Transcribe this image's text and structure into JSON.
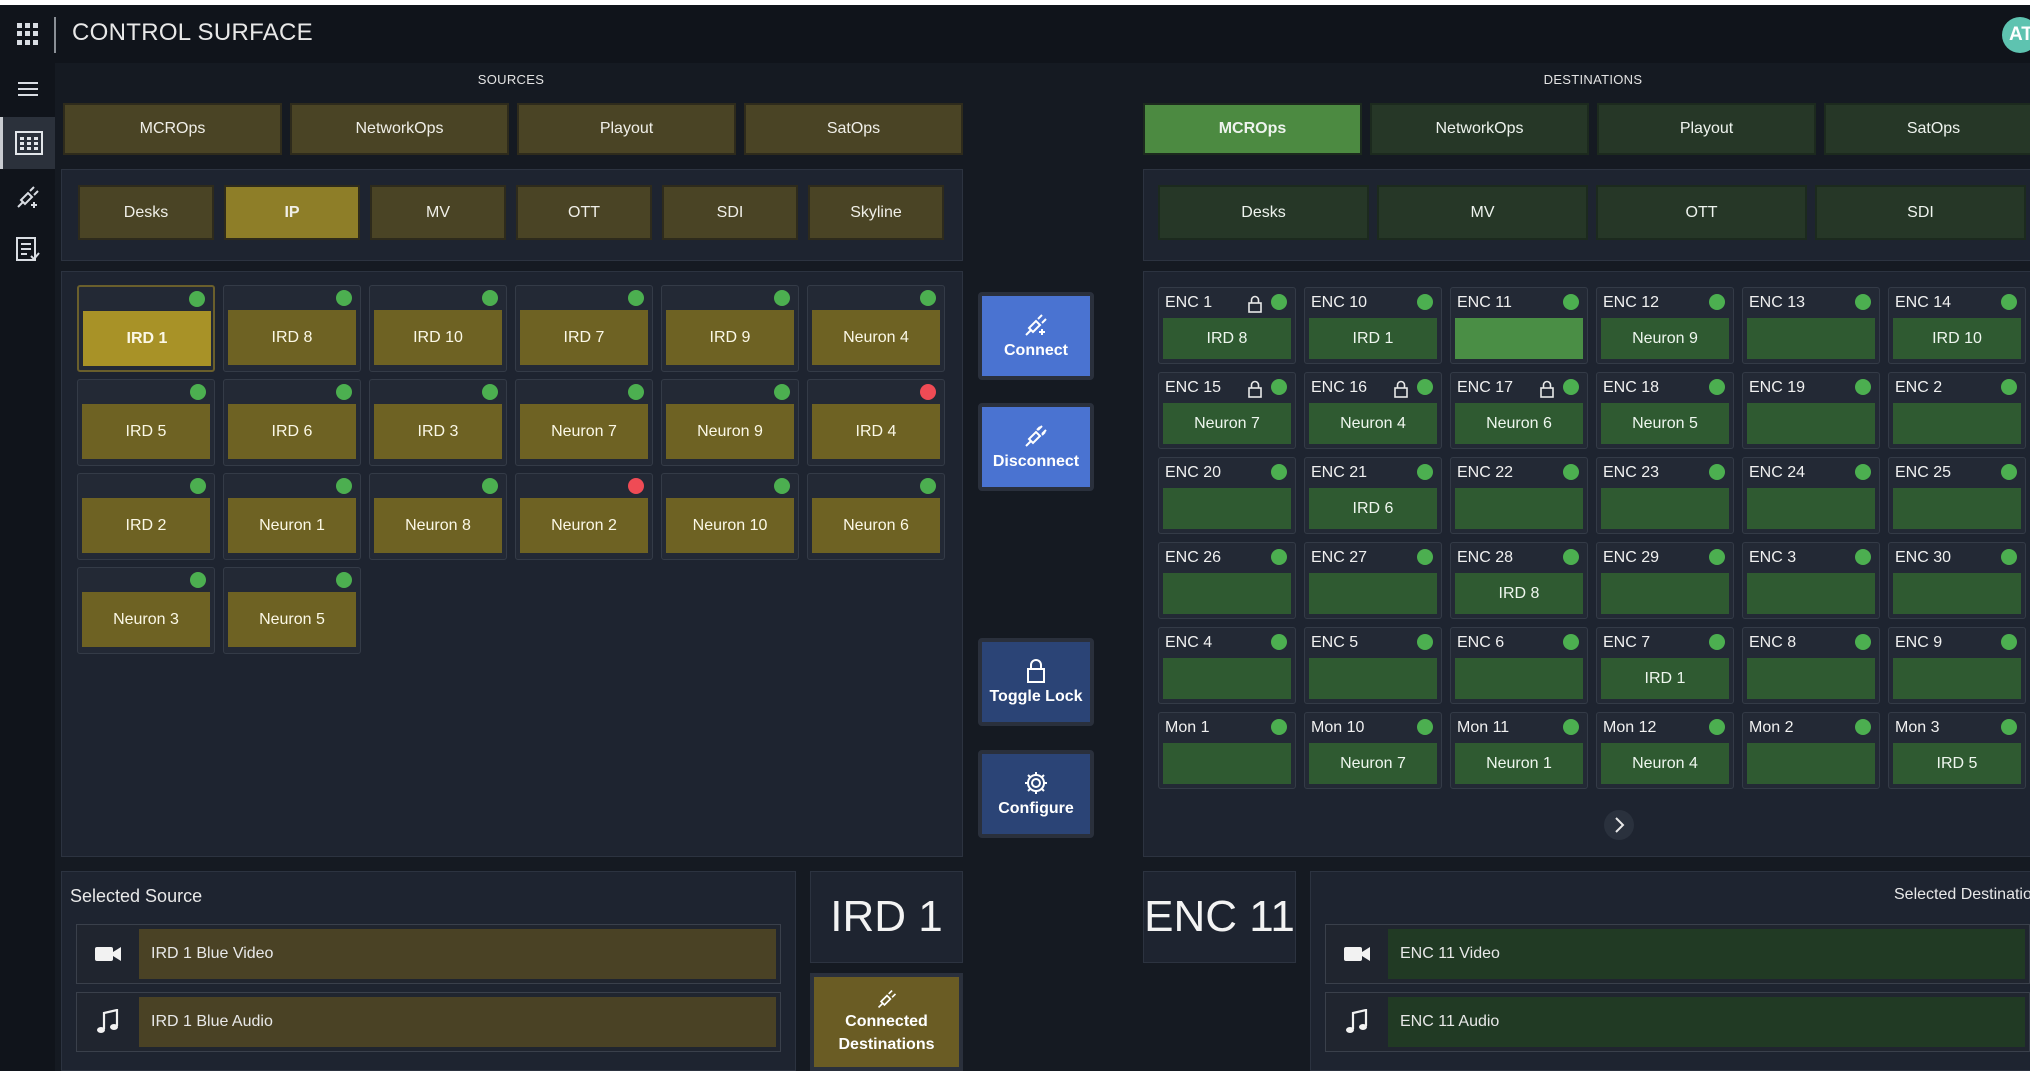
{
  "app": {
    "title": "CONTROL SURFACE",
    "user_initials": "AT"
  },
  "sidebar": {
    "icons": [
      "menu-icon",
      "grid-panel-icon",
      "connect-plug-icon",
      "list-check-icon"
    ]
  },
  "sources": {
    "header": "SOURCES",
    "groups": [
      {
        "label": "MCROps",
        "selected": false
      },
      {
        "label": "NetworkOps",
        "selected": false
      },
      {
        "label": "Playout",
        "selected": false
      },
      {
        "label": "SatOps",
        "selected": false
      }
    ],
    "categories": [
      {
        "label": "Desks",
        "selected": false
      },
      {
        "label": "IP",
        "selected": true
      },
      {
        "label": "MV",
        "selected": false
      },
      {
        "label": "OTT",
        "selected": false
      },
      {
        "label": "SDI",
        "selected": false
      },
      {
        "label": "Skyline",
        "selected": false
      }
    ],
    "tiles": [
      {
        "label": "IRD 1",
        "status": "ok",
        "selected": true
      },
      {
        "label": "IRD 8",
        "status": "ok"
      },
      {
        "label": "IRD 10",
        "status": "ok"
      },
      {
        "label": "IRD 7",
        "status": "ok"
      },
      {
        "label": "IRD 9",
        "status": "ok"
      },
      {
        "label": "Neuron 4",
        "status": "ok"
      },
      {
        "label": "IRD 5",
        "status": "ok"
      },
      {
        "label": "IRD 6",
        "status": "ok"
      },
      {
        "label": "IRD 3",
        "status": "ok"
      },
      {
        "label": "Neuron 7",
        "status": "ok"
      },
      {
        "label": "Neuron 9",
        "status": "ok"
      },
      {
        "label": "IRD 4",
        "status": "error"
      },
      {
        "label": "IRD 2",
        "status": "ok"
      },
      {
        "label": "Neuron 1",
        "status": "ok"
      },
      {
        "label": "Neuron 8",
        "status": "ok"
      },
      {
        "label": "Neuron 2",
        "status": "error"
      },
      {
        "label": "Neuron 10",
        "status": "ok"
      },
      {
        "label": "Neuron 6",
        "status": "ok"
      },
      {
        "label": "Neuron 3",
        "status": "ok"
      },
      {
        "label": "Neuron 5",
        "status": "ok"
      }
    ]
  },
  "actions": {
    "connect": "Connect",
    "disconnect": "Disconnect",
    "toggle_lock": "Toggle Lock",
    "configure": "Configure",
    "connected_destinations": "Connected Destinations"
  },
  "destinations": {
    "header": "DESTINATIONS",
    "groups": [
      {
        "label": "MCROps",
        "selected": true
      },
      {
        "label": "NetworkOps",
        "selected": false
      },
      {
        "label": "Playout",
        "selected": false
      },
      {
        "label": "SatOps",
        "selected": false
      }
    ],
    "categories": [
      {
        "label": "Desks"
      },
      {
        "label": "MV"
      },
      {
        "label": "OTT"
      },
      {
        "label": "SDI"
      }
    ],
    "tiles": [
      {
        "name": "ENC 1",
        "source": "IRD 8",
        "locked": true
      },
      {
        "name": "ENC 10",
        "source": "IRD 1",
        "locked": false
      },
      {
        "name": "ENC 11",
        "source": "",
        "locked": false,
        "selected": true
      },
      {
        "name": "ENC 12",
        "source": "Neuron 9",
        "locked": false
      },
      {
        "name": "ENC 13",
        "source": "",
        "locked": false
      },
      {
        "name": "ENC 14",
        "source": "IRD 10",
        "locked": false
      },
      {
        "name": "ENC 15",
        "source": "Neuron 7",
        "locked": true
      },
      {
        "name": "ENC 16",
        "source": "Neuron 4",
        "locked": true
      },
      {
        "name": "ENC 17",
        "source": "Neuron 6",
        "locked": true
      },
      {
        "name": "ENC 18",
        "source": "Neuron 5",
        "locked": false
      },
      {
        "name": "ENC 19",
        "source": "",
        "locked": false
      },
      {
        "name": "ENC 2",
        "source": "",
        "locked": false
      },
      {
        "name": "ENC 20",
        "source": "",
        "locked": false
      },
      {
        "name": "ENC 21",
        "source": "IRD 6",
        "locked": false
      },
      {
        "name": "ENC 22",
        "source": "",
        "locked": false
      },
      {
        "name": "ENC 23",
        "source": "",
        "locked": false
      },
      {
        "name": "ENC 24",
        "source": "",
        "locked": false
      },
      {
        "name": "ENC 25",
        "source": "",
        "locked": false
      },
      {
        "name": "ENC 26",
        "source": "",
        "locked": false
      },
      {
        "name": "ENC 27",
        "source": "",
        "locked": false
      },
      {
        "name": "ENC 28",
        "source": "IRD 8",
        "locked": false
      },
      {
        "name": "ENC 29",
        "source": "",
        "locked": false
      },
      {
        "name": "ENC 3",
        "source": "",
        "locked": false
      },
      {
        "name": "ENC 30",
        "source": "",
        "locked": false
      },
      {
        "name": "ENC 4",
        "source": "",
        "locked": false
      },
      {
        "name": "ENC 5",
        "source": "",
        "locked": false
      },
      {
        "name": "ENC 6",
        "source": "",
        "locked": false
      },
      {
        "name": "ENC 7",
        "source": "IRD 1",
        "locked": false
      },
      {
        "name": "ENC 8",
        "source": "",
        "locked": false
      },
      {
        "name": "ENC 9",
        "source": "",
        "locked": false
      },
      {
        "name": "Mon 1",
        "source": "",
        "locked": false
      },
      {
        "name": "Mon 10",
        "source": "Neuron 7",
        "locked": false
      },
      {
        "name": "Mon 11",
        "source": "Neuron 1",
        "locked": false
      },
      {
        "name": "Mon 12",
        "source": "Neuron 4",
        "locked": false
      },
      {
        "name": "Mon 2",
        "source": "",
        "locked": false
      },
      {
        "name": "Mon 3",
        "source": "IRD 5",
        "locked": false
      }
    ]
  },
  "selected_source": {
    "title": "Selected Source",
    "name": "IRD 1",
    "video": "IRD 1 Blue Video",
    "audio": "IRD 1 Blue Audio"
  },
  "selected_destination": {
    "title": "Selected Destination",
    "name": "ENC 11",
    "video": "ENC 11 Video",
    "audio": "ENC 11 Audio"
  },
  "colors": {
    "source_accent": "#a89227",
    "destination_accent": "#4c8a41",
    "action_blue": "#4a73d1",
    "status_ok": "#4caf50",
    "status_error": "#ef4b55"
  }
}
